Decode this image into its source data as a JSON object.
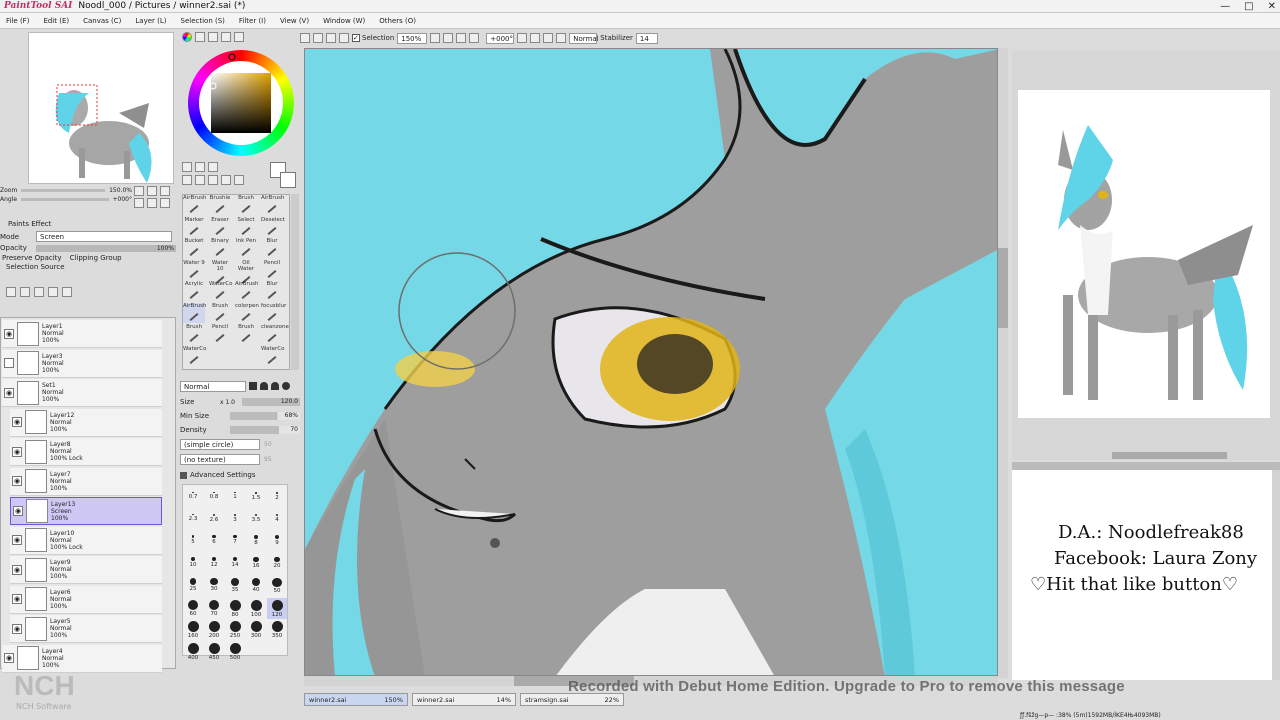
{
  "window": {
    "app_name": "PaintTool SAI",
    "title": "Noodl_000 / Pictures / winner2.sai (*)",
    "controls": [
      "—",
      "□",
      "✕"
    ]
  },
  "menu": [
    "File (F)",
    "Edit (E)",
    "Canvas (C)",
    "Layer (L)",
    "Selection (S)",
    "Filter (I)",
    "View (V)",
    "Window (W)",
    "Others (O)"
  ],
  "toolbar": {
    "selection_label": "Selection",
    "selection_checked": true,
    "zoom": "150%",
    "rotation": "+000°",
    "blend": "Normal",
    "stabilizer_label": "Stabilizer",
    "stabilizer_value": "14"
  },
  "navigator": {
    "zoom_label": "Zoom",
    "zoom_value": "150.0%",
    "angle_label": "Angle",
    "angle_value": "+000°"
  },
  "paint_effect": {
    "header": "Paints Effect",
    "mode_label": "Mode",
    "mode_value": "Screen",
    "opacity_label": "Opacity",
    "opacity_value": "100%",
    "preserve_opacity": "Preserve Opacity",
    "clipping_group": "Clipping Group",
    "selection_source": "Selection Source"
  },
  "layers": [
    {
      "name": "Layer1",
      "mode": "Normal",
      "opacity": "100%",
      "visible": true,
      "selected": false
    },
    {
      "name": "Layer3",
      "mode": "Normal",
      "opacity": "100%",
      "visible": false,
      "selected": false
    },
    {
      "name": "Set1",
      "mode": "Normal",
      "opacity": "100%",
      "visible": true,
      "selected": false
    },
    {
      "name": "Layer12",
      "mode": "Normal",
      "opacity": "100%",
      "visible": true,
      "selected": false
    },
    {
      "name": "Layer8",
      "mode": "Normal",
      "opacity": "100% Lock",
      "visible": true,
      "selected": false
    },
    {
      "name": "Layer7",
      "mode": "Normal",
      "opacity": "100%",
      "visible": true,
      "selected": false
    },
    {
      "name": "Layer13",
      "mode": "Screen",
      "opacity": "100%",
      "visible": true,
      "selected": true
    },
    {
      "name": "Layer10",
      "mode": "Normal",
      "opacity": "100% Lock",
      "visible": true,
      "selected": false
    },
    {
      "name": "Layer9",
      "mode": "Normal",
      "opacity": "100%",
      "visible": true,
      "selected": false
    },
    {
      "name": "Layer6",
      "mode": "Normal",
      "opacity": "100%",
      "visible": true,
      "selected": false
    },
    {
      "name": "Layer5",
      "mode": "Normal",
      "opacity": "100%",
      "visible": true,
      "selected": false
    },
    {
      "name": "Layer4",
      "mode": "Normal",
      "opacity": "100%",
      "visible": true,
      "selected": false
    }
  ],
  "tools": [
    [
      "AirBrush",
      "Brushie",
      "Brush",
      "AirBrush"
    ],
    [
      "Marker",
      "Eraser",
      "Select",
      "Deselect"
    ],
    [
      "Bucket",
      "Binary",
      "Ink Pen",
      "Blur"
    ],
    [
      "Water 9",
      "Water 10",
      "Oil Water",
      "Pencil"
    ],
    [
      "Acrylic",
      "WaterCo",
      "AirBrush",
      "Blur"
    ],
    [
      "AirBrush",
      "Brush",
      "colorpen",
      "focusblur"
    ],
    [
      "Brush",
      "Pencil",
      "Brush",
      "cleanzone"
    ],
    [
      "WaterCo",
      "",
      "",
      "WaterCo"
    ]
  ],
  "brush": {
    "blend": "Normal",
    "size_label": "Size",
    "size_mult": "x 1.0",
    "size_value": "120.0",
    "min_size_label": "Min Size",
    "min_size_value": "68%",
    "density_label": "Density",
    "density_value": "70",
    "shape": "(simple circle)",
    "shape_value": "50",
    "texture": "(no texture)",
    "texture_value": "95",
    "advanced": "Advanced Settings"
  },
  "brush_sizes": [
    "0.7",
    "0.8",
    "1",
    "1.5",
    "2",
    "2.3",
    "2.6",
    "3",
    "3.5",
    "4",
    "5",
    "6",
    "7",
    "8",
    "9",
    "10",
    "12",
    "14",
    "16",
    "20",
    "25",
    "30",
    "35",
    "40",
    "50",
    "60",
    "70",
    "80",
    "100",
    "120",
    "160",
    "200",
    "250",
    "300",
    "350",
    "400",
    "450",
    "500"
  ],
  "doc_tabs": [
    {
      "name": "winner2.sai",
      "zoom": "150%",
      "active": true
    },
    {
      "name": "winner2.sai",
      "zoom": "14%",
      "active": false
    },
    {
      "name": "stramsign.sai",
      "zoom": "22%",
      "active": false
    }
  ],
  "signature": {
    "line1": "D.A.: Noodlefreak88",
    "line2": "Facebook: Laura Zony",
    "line3": "♡Hit that like button♡"
  },
  "watermark": "Recorded with Debut Home Edition. Upgrade to Pro to remove this message",
  "nch_logo": "NCH",
  "nch_sub": "NCH Software",
  "status": "ƒƒ.fšžg—p— :38% (5m)1592MB/İKE4Њ4093MB)",
  "colors": {
    "canvas_bg": "#75d8e6",
    "fur": "#9b9b9b",
    "eye": "#e0b418",
    "selection": "#d0c8f4"
  }
}
